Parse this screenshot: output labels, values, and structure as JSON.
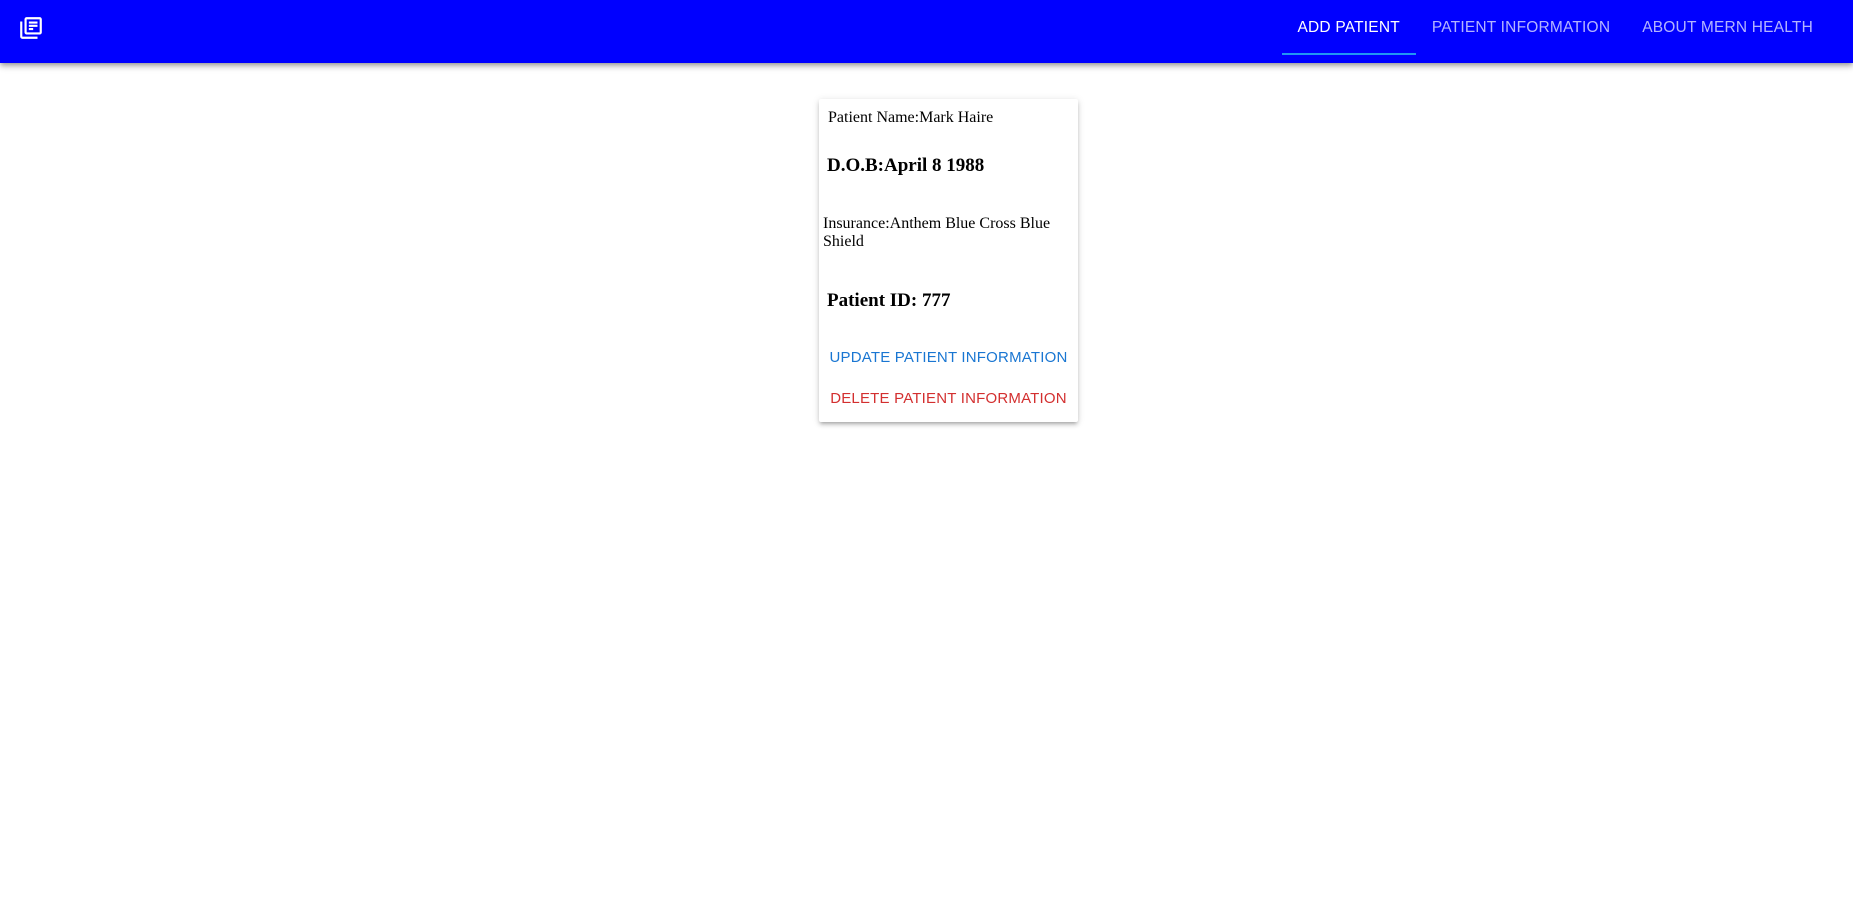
{
  "appbar": {
    "background_color": "#0000ff",
    "logo_icon": "library-books-icon",
    "tabs": [
      {
        "label": "ADD PATIENT",
        "active": true
      },
      {
        "label": "PATIENT INFORMATION",
        "active": false
      },
      {
        "label": "ABOUT MERN HEALTH",
        "active": false
      }
    ],
    "indicator_color": "#2196f3"
  },
  "patient_card": {
    "name_label": "Patient Name:",
    "name_value": "Mark Haire",
    "dob_label": "D.O.B:",
    "dob_value": "April 8 1988",
    "insurance_label": "Insurance:",
    "insurance_value": "Anthem Blue Cross Blue Shield",
    "id_label": "Patient ID: ",
    "id_value": "777",
    "update_button": "UPDATE PATIENT INFORMATION",
    "delete_button": "DELETE PATIENT INFORMATION",
    "update_color": "#1976d2",
    "delete_color": "#d32f2f"
  }
}
